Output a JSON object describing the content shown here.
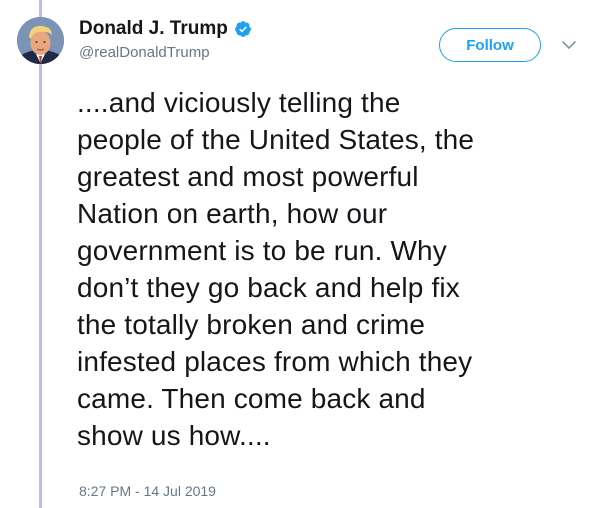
{
  "author": {
    "display_name": "Donald J. Trump",
    "handle": "@realDonaldTrump",
    "verified": true,
    "avatar_icon": "profile-photo"
  },
  "actions": {
    "follow_label": "Follow",
    "more_icon": "chevron-down-icon"
  },
  "tweet": {
    "text": "....and viciously telling the\npeople of the United States, the\ngreatest and most powerful\nNation on earth, how our\ngovernment is to be run. Why\ndon’t they go back and help fix\nthe totally broken and crime\ninfested places from which they\ncame. Then come back and\nshow us how....",
    "timestamp": "8:27 PM - 14 Jul 2019"
  },
  "colors": {
    "accent": "#1da1f2",
    "thread_line": "#c8b7ef",
    "secondary_text": "#657786",
    "primary_text": "#14171a"
  }
}
